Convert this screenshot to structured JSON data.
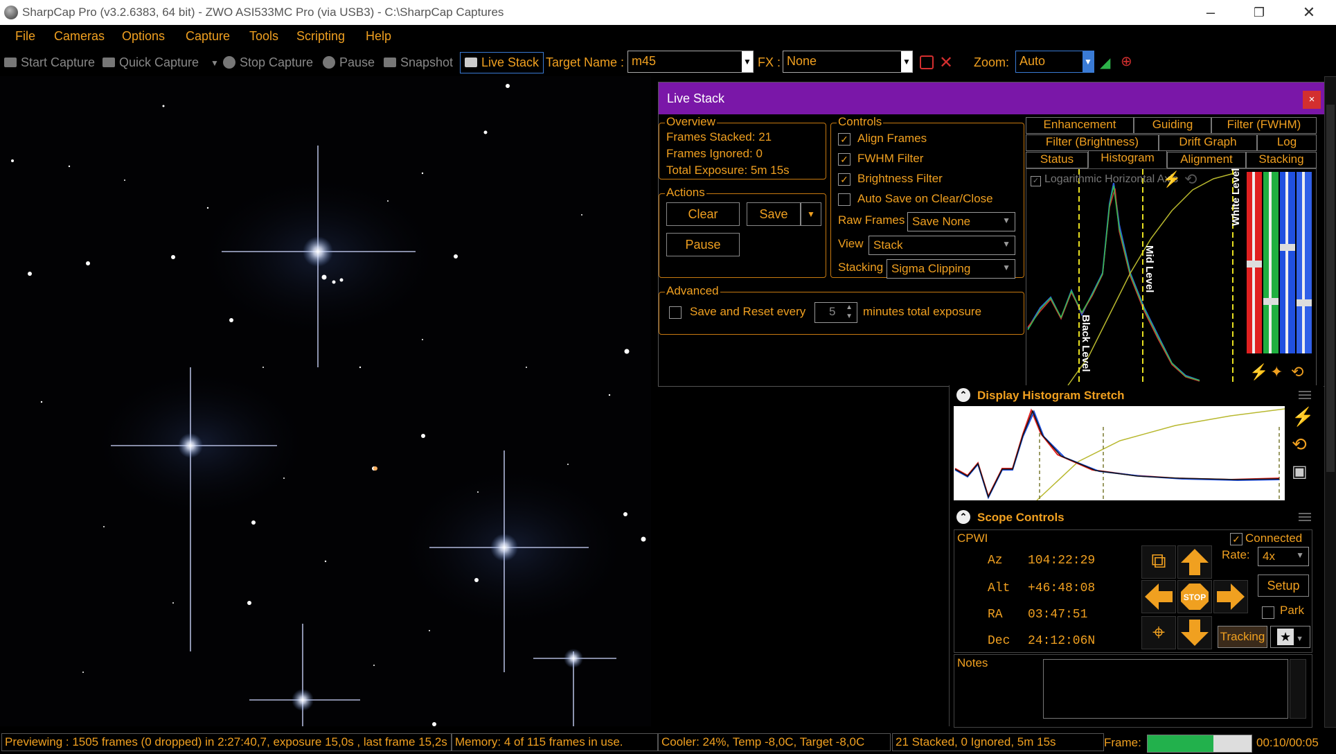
{
  "window": {
    "title": "SharpCap Pro (v3.2.6383, 64 bit) - ZWO ASI533MC Pro (via USB3) - C:\\SharpCap Captures"
  },
  "menu": [
    "File",
    "Cameras",
    "Options",
    "Capture",
    "Tools",
    "Scripting",
    "Help"
  ],
  "toolbar": {
    "start_capture": "Start Capture",
    "quick_capture": "Quick Capture",
    "stop_capture": "Stop Capture",
    "pause": "Pause",
    "snapshot": "Snapshot",
    "live_stack": "Live Stack",
    "target_label": "Target Name :",
    "target_value": "m45",
    "fx_label": "FX :",
    "fx_value": "None",
    "zoom_label": "Zoom:",
    "zoom_value": "Auto"
  },
  "live_stack": {
    "title": "Live Stack",
    "close": "×",
    "overview": {
      "title": "Overview",
      "frames_stacked": "Frames Stacked: 21",
      "frames_ignored": "Frames Ignored:  0",
      "total_exposure": "Total Exposure:   5m 15s"
    },
    "actions": {
      "title": "Actions",
      "clear": "Clear",
      "save": "Save",
      "pause": "Pause"
    },
    "controls": {
      "title": "Controls",
      "align_frames": "Align Frames",
      "fwhm_filter": "FWHM Filter",
      "brightness_filter": "Brightness Filter",
      "auto_save": "Auto Save on Clear/Close",
      "raw_frames_label": "Raw Frames",
      "raw_frames_value": "Save None",
      "view_label": "View",
      "view_value": "Stack",
      "stacking_label": "Stacking",
      "stacking_value": "Sigma Clipping"
    },
    "advanced": {
      "title": "Advanced",
      "save_reset": "Save and Reset every",
      "minutes_value": "5",
      "minutes_label": "minutes total exposure"
    },
    "tabs_row1": [
      "Enhancement",
      "Guiding",
      "Filter (FWHM)"
    ],
    "tabs_row2": [
      "Filter (Brightness)",
      "Drift Graph",
      "Log"
    ],
    "tabs_row3": [
      "Status",
      "Histogram",
      "Alignment",
      "Stacking"
    ],
    "histogram": {
      "log_axis": "Logarithmic Horizontal Axis",
      "black_level": "Black Level",
      "mid_level": "Mid Level",
      "white_level": "White Level"
    }
  },
  "display_histogram": {
    "title": "Display Histogram Stretch"
  },
  "scope": {
    "title": "Scope Controls",
    "device": "CPWI",
    "connected": "Connected",
    "az_label": "Az",
    "az_value": "104:22:29",
    "alt_label": "Alt",
    "alt_value": "+46:48:08",
    "ra_label": "RA",
    "ra_value": "03:47:51",
    "dec_label": "Dec",
    "dec_value": "24:12:06N",
    "rate_label": "Rate:",
    "rate_value": "4x",
    "setup": "Setup",
    "park": "Park",
    "stop": "STOP",
    "tracking": "Tracking",
    "notes_label": "Notes"
  },
  "status": {
    "previewing": "Previewing : 1505 frames (0 dropped) in 2:27:40,7, exposure 15,0s , last frame 15,2s",
    "memory": "Memory: 4 of 115 frames in use.",
    "cooler": "Cooler: 24%, Temp -8,0C, Target -8,0C",
    "stacked": "21 Stacked, 0 Ignored, 5m 15s",
    "frame_label": "Frame:",
    "frame_progress": 0.63,
    "frame_time": "00:10/00:05"
  },
  "colors": {
    "accent": "#f0a020",
    "titlebar_purple": "#7a17a8",
    "progress_green": "#22b14c"
  }
}
